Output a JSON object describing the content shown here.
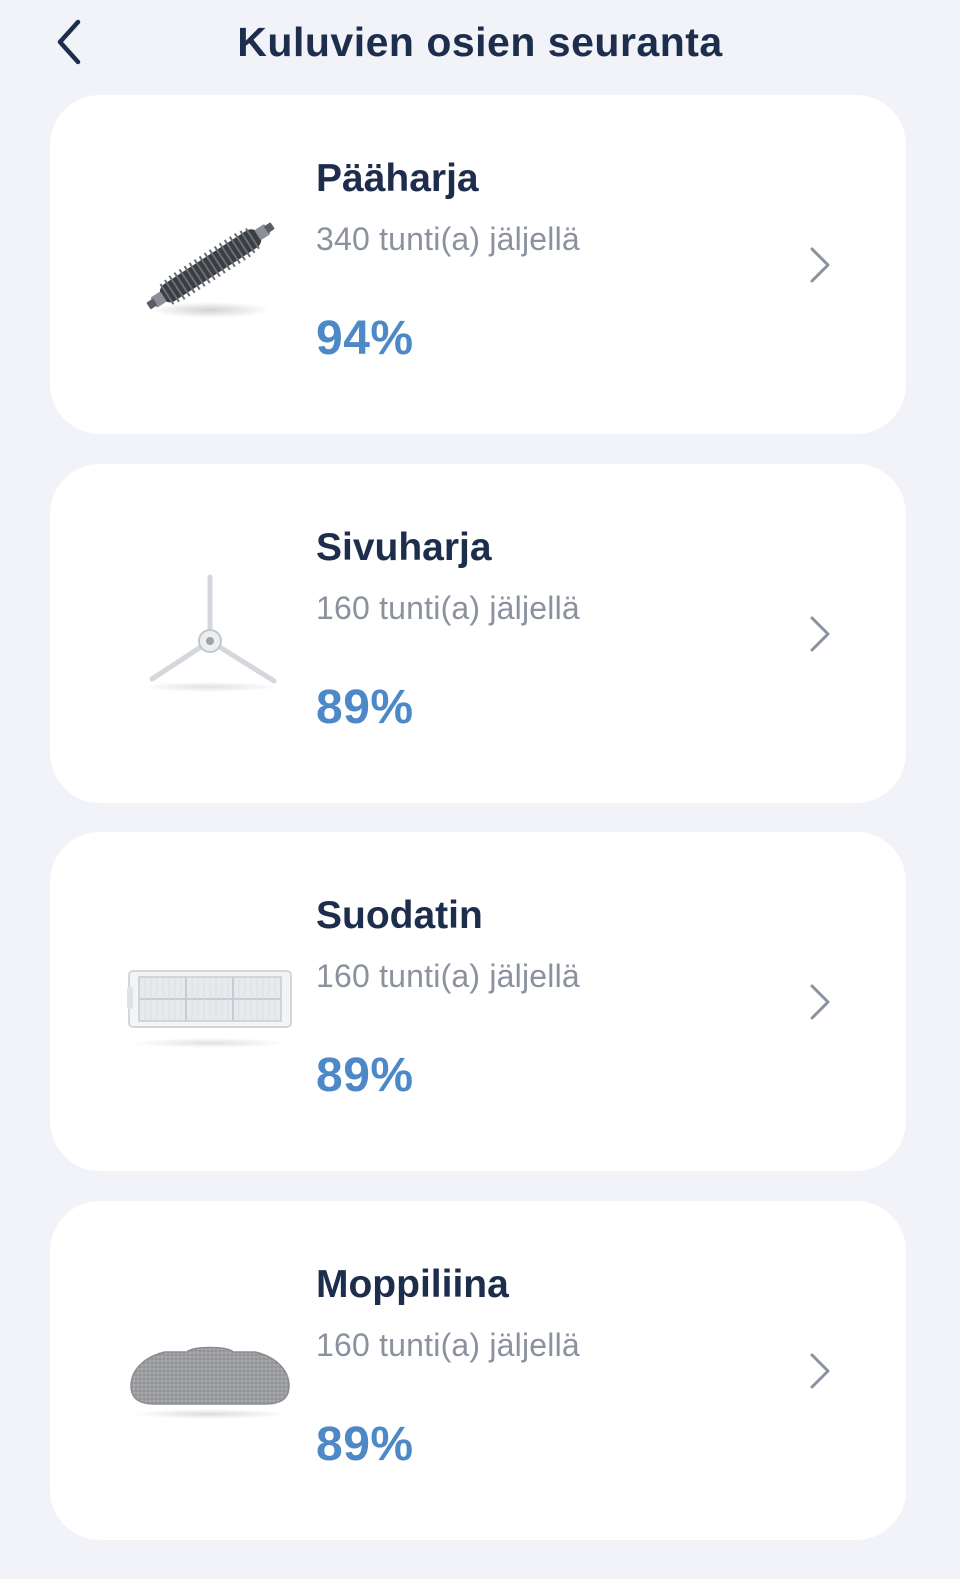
{
  "header": {
    "title": "Kuluvien osien seuranta",
    "back_icon": "chevron-left-icon"
  },
  "colors": {
    "background": "#f1f3f9",
    "card": "#ffffff",
    "title_text": "#1d2d4c",
    "secondary_text": "#8c919f",
    "percent_text": "#4d88c7"
  },
  "parts": [
    {
      "name": "Pääharja",
      "remaining": "340 tunti(a) jäljellä",
      "percent": "94%",
      "icon": "main-brush-icon"
    },
    {
      "name": "Sivuharja",
      "remaining": "160 tunti(a) jäljellä",
      "percent": "89%",
      "icon": "side-brush-icon"
    },
    {
      "name": "Suodatin",
      "remaining": "160 tunti(a) jäljellä",
      "percent": "89%",
      "icon": "filter-icon"
    },
    {
      "name": "Moppiliina",
      "remaining": "160 tunti(a) jäljellä",
      "percent": "89%",
      "icon": "mop-pad-icon"
    }
  ]
}
